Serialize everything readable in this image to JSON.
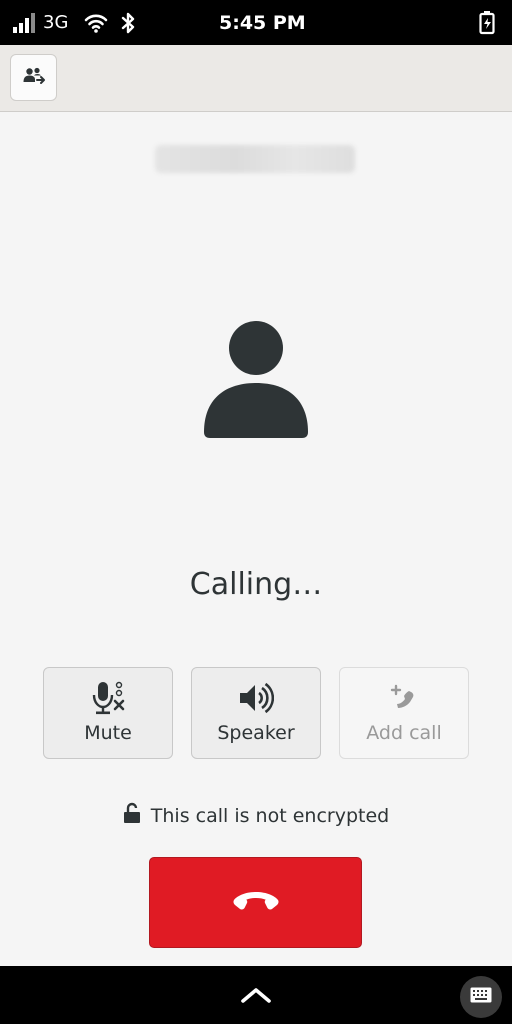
{
  "status_bar": {
    "network": "3G",
    "time": "5:45 PM",
    "icons": [
      "signal-icon",
      "wifi-icon",
      "bluetooth-icon",
      "battery-charging-icon"
    ]
  },
  "header": {
    "contacts_button_icon": "contacts-icon"
  },
  "call": {
    "caller_id": "",
    "status": "Calling…",
    "buttons": [
      {
        "label": "Mute",
        "icon": "microphone-muted-icon",
        "enabled": true
      },
      {
        "label": "Speaker",
        "icon": "speaker-icon",
        "enabled": true
      },
      {
        "label": "Add call",
        "icon": "add-call-icon",
        "enabled": false
      }
    ],
    "encryption_text": "This call is not encrypted",
    "hangup_icon": "hangup-icon"
  },
  "nav": {
    "up_icon": "chevron-up-icon",
    "keyboard_icon": "keyboard-icon"
  },
  "colors": {
    "hangup": "#e01b24",
    "foreground": "#2e3436",
    "background": "#f5f5f5"
  }
}
